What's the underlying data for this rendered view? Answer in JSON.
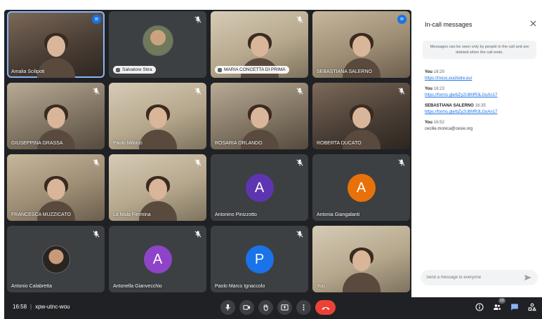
{
  "tiles": [
    {
      "name": "Amalia Scilipoti",
      "kind": "video",
      "style": "v1",
      "icon": "speaking-icon"
    },
    {
      "name": "Salvatore Stira",
      "kind": "avatar-photo",
      "icon": "mic-off-icon",
      "chip": true
    },
    {
      "name": "MARIA CONCETTA DI PRIMA",
      "kind": "video",
      "style": "v5",
      "icon": "mic-off-icon",
      "chip": true
    },
    {
      "name": "SEBASTIANA SALERNO",
      "kind": "video",
      "style": "v3",
      "icon": "speaking-icon"
    },
    {
      "name": "GIUSEPPINA GRASSA",
      "kind": "video",
      "style": "v2",
      "icon": "mic-off-icon"
    },
    {
      "name": "Paolo Milonzi",
      "kind": "video",
      "style": "v5",
      "icon": "mic-off-icon"
    },
    {
      "name": "ROSARIA ORLANDO",
      "kind": "video",
      "style": "v2",
      "icon": "mic-off-icon"
    },
    {
      "name": "ROBERTA DUCATO",
      "kind": "video",
      "style": "v1",
      "icon": "mic-off-icon"
    },
    {
      "name": "FRANCESCA MUZZICATO",
      "kind": "video",
      "style": "v3",
      "icon": "mic-off-icon"
    },
    {
      "name": "La Mala Fimmina",
      "kind": "video",
      "style": "v5",
      "icon": "mic-off-icon"
    },
    {
      "name": "Antonino Pinizzotto",
      "kind": "avatar",
      "letter": "A",
      "color": "#5e35b1",
      "icon": "mic-off-icon"
    },
    {
      "name": "Antonia Giangalanti",
      "kind": "avatar",
      "letter": "A",
      "color": "#e8710a",
      "icon": "mic-off-icon"
    },
    {
      "name": "Antonio Calabretta",
      "kind": "avatar-photo",
      "icon": "mic-off-icon"
    },
    {
      "name": "Antonella Gianvecchio",
      "kind": "avatar",
      "letter": "A",
      "color": "#8e44c8",
      "icon": "mic-off-icon"
    },
    {
      "name": "Paolo Marco Ignaccolo",
      "kind": "avatar",
      "letter": "P",
      "color": "#1a73e8",
      "icon": "mic-off-icon"
    },
    {
      "name": "You",
      "kind": "video",
      "style": "v5",
      "icon": ""
    }
  ],
  "bottom_bar": {
    "time": "16:58",
    "separator": "|",
    "meeting_code": "xpw-utnc-wou",
    "participants_badge": "16",
    "colors": {
      "bar": "#202124",
      "hangup": "#ea4335",
      "button": "#3c4043"
    }
  },
  "chat": {
    "title": "In-call messages",
    "notice": "Messages can be seen only by people in the call and are deleted when the call ends.",
    "messages": [
      {
        "sender": "You",
        "time": "16:20",
        "link": "https://mooc.eucheire.eu/",
        "text": ""
      },
      {
        "sender": "You",
        "time": "16:23",
        "link": "https://forms.gle/bZy2U8hfR3LGoAn17",
        "text": ""
      },
      {
        "sender": "SEBASTIANA SALERNO",
        "time": "16:35",
        "link": "https://forms.gle/bZy2U8hfR3LGoAn17",
        "text": ""
      },
      {
        "sender": "You",
        "time": "16:52",
        "link": "",
        "text": "cecilie.monica@cesie.org"
      }
    ],
    "input_placeholder": "Send a message to everyone"
  }
}
